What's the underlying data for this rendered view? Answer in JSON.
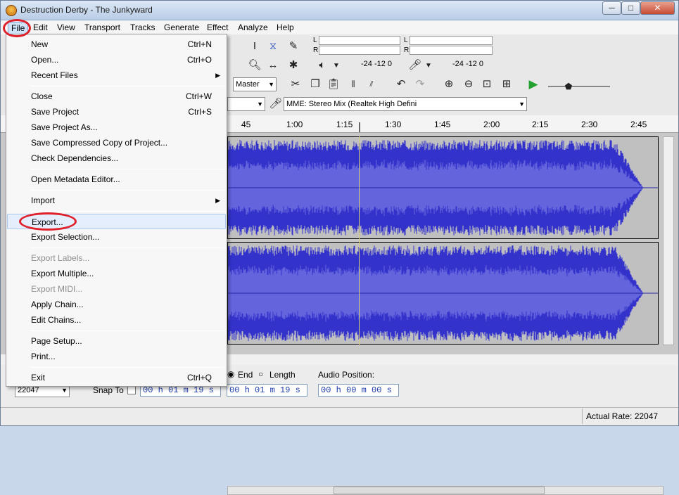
{
  "window": {
    "title": "Destruction Derby - The Junkyward"
  },
  "controls": {
    "minimize": "─",
    "maximize": "□",
    "close": "✕"
  },
  "menubar": [
    "File",
    "Edit",
    "View",
    "Transport",
    "Tracks",
    "Generate",
    "Effect",
    "Analyze",
    "Help"
  ],
  "file_menu": [
    {
      "label": "New",
      "shortcut": "Ctrl+N"
    },
    {
      "label": "Open...",
      "shortcut": "Ctrl+O"
    },
    {
      "label": "Recent Files",
      "submenu": true
    },
    {
      "label": "Close",
      "shortcut": "Ctrl+W"
    },
    {
      "label": "Save Project",
      "shortcut": "Ctrl+S"
    },
    {
      "label": "Save Project As..."
    },
    {
      "label": "Save Compressed Copy of Project..."
    },
    {
      "label": "Check Dependencies..."
    },
    {
      "label": "Open Metadata Editor..."
    },
    {
      "label": "Import",
      "submenu": true
    },
    {
      "label": "Export...",
      "highlighted": true
    },
    {
      "label": "Export Selection..."
    },
    {
      "label": "Export Labels...",
      "disabled": true
    },
    {
      "label": "Export Multiple..."
    },
    {
      "label": "Export MIDI...",
      "disabled": true
    },
    {
      "label": "Apply Chain..."
    },
    {
      "label": "Edit Chains..."
    },
    {
      "label": "Page Setup..."
    },
    {
      "label": "Print..."
    },
    {
      "label": "Exit",
      "shortcut": "Ctrl+Q"
    }
  ],
  "meters": {
    "channel_l": "L",
    "channel_r": "R",
    "play_scale": "-24  -12  0",
    "rec_scale": "-24  -12  0"
  },
  "mixer": {
    "master": "Master"
  },
  "devices": {
    "input_device": "MME: Stereo Mix (Realtek High Defini"
  },
  "ruler_ticks": [
    "45",
    "1:00",
    "1:15",
    "1:30",
    "1:45",
    "2:00",
    "2:15",
    "2:30",
    "2:45"
  ],
  "selection": {
    "end_label": "End",
    "length_label": "Length",
    "audio_position_label": "Audio Position:",
    "project_rate": "22047",
    "snap_to_label": "Snap To",
    "start_time": "00 h 01 m 19 s",
    "end_time": "00 h 01 m 19 s",
    "audio_position": "00 h 00 m 00 s"
  },
  "status": {
    "actual_rate": "Actual Rate: 22047"
  },
  "colors": {
    "waveform": "#3333cc",
    "waveform_rms": "#6464dc",
    "highlight_ring": "#e0202a"
  }
}
